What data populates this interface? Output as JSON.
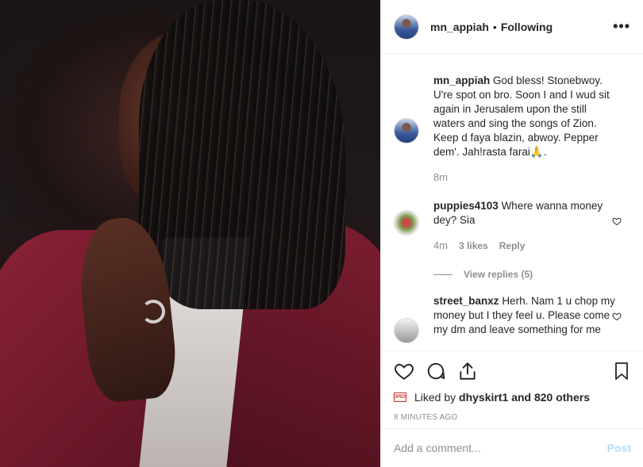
{
  "post": {
    "author": "mn_appiah",
    "separator": "•",
    "follow_status": "Following",
    "more_label": "•••"
  },
  "comments": [
    {
      "user": "mn_appiah",
      "text": "God bless! Stonebwoy. U're spot on bro. Soon I and I wud sit again in Jerusalem upon the still waters and sing the songs of Zion. Keep d faya blazin, abwoy. Pepper dem'. Jah!rasta farai🙏.",
      "time": "8m"
    },
    {
      "user": "puppies4103",
      "text": "Where wanna money dey? Sia",
      "time": "4m",
      "likes": "3 likes",
      "reply": "Reply",
      "view_replies": "View replies (5)"
    },
    {
      "user": "street_banxz",
      "text": "Herh. Nam 1 u chop my money but I they feel u. Please come my dm and leave something for me"
    }
  ],
  "likes": {
    "mini_label": "OPEN",
    "prefix": "Liked by",
    "user": "dhyskirt1",
    "suffix": "and 820 others"
  },
  "timestamp": "8 MINUTES AGO",
  "add_comment": {
    "placeholder": "Add a comment...",
    "post_label": "Post"
  },
  "colors": {
    "post_disabled": "#b3dbff",
    "muted": "#8e8e8e",
    "text": "#262626"
  }
}
